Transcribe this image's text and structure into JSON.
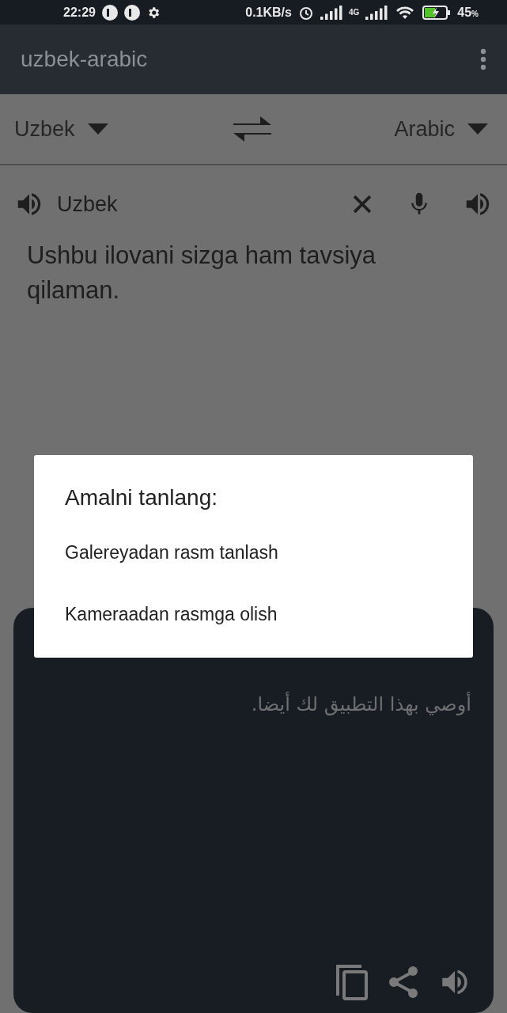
{
  "status_bar": {
    "time": "22:29",
    "network_speed": "0.1KB/s",
    "network_type": "4G",
    "battery": "45",
    "battery_unit": "%"
  },
  "app_bar": {
    "title": "uzbek-arabic"
  },
  "language_bar": {
    "source": "Uzbek",
    "target": "Arabic"
  },
  "input": {
    "language": "Uzbek",
    "text": "Ushbu ilovani sizga ham tavsiya qilaman."
  },
  "output": {
    "text": "أوصي بهذا التطبيق لك أيضا."
  },
  "dialog": {
    "title": "Amalni tanlang:",
    "options": [
      "Galereyadan rasm tanlash",
      "Kameraadan rasmga olish"
    ]
  }
}
